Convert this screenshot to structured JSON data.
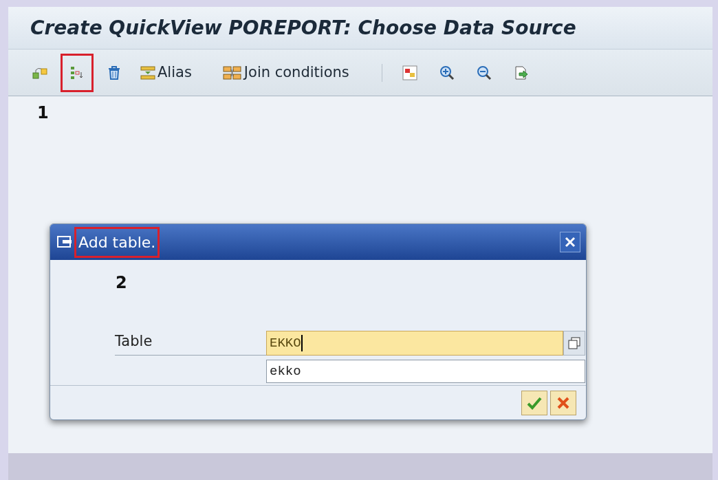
{
  "window": {
    "title": "Create QuickView POREPORT: Choose Data Source"
  },
  "toolbar": {
    "items": [
      {
        "kind": "icon",
        "highlighted": false
      },
      {
        "kind": "icon",
        "highlighted": true
      },
      {
        "kind": "icon",
        "highlighted": false
      },
      {
        "kind": "button",
        "label": "Alias",
        "highlighted": false
      },
      {
        "kind": "button",
        "label": "Join conditions",
        "highlighted": false
      },
      {
        "kind": "separator"
      },
      {
        "kind": "icon",
        "highlighted": false
      },
      {
        "kind": "icon",
        "highlighted": false
      },
      {
        "kind": "icon",
        "highlighted": false
      },
      {
        "kind": "icon",
        "highlighted": false
      }
    ],
    "step": "1"
  },
  "dialog": {
    "title": "Add table.",
    "title_highlighted": true,
    "step": "2",
    "field": {
      "label": "Table",
      "value": "EKKO"
    },
    "suggestions": [
      "ekko"
    ]
  }
}
